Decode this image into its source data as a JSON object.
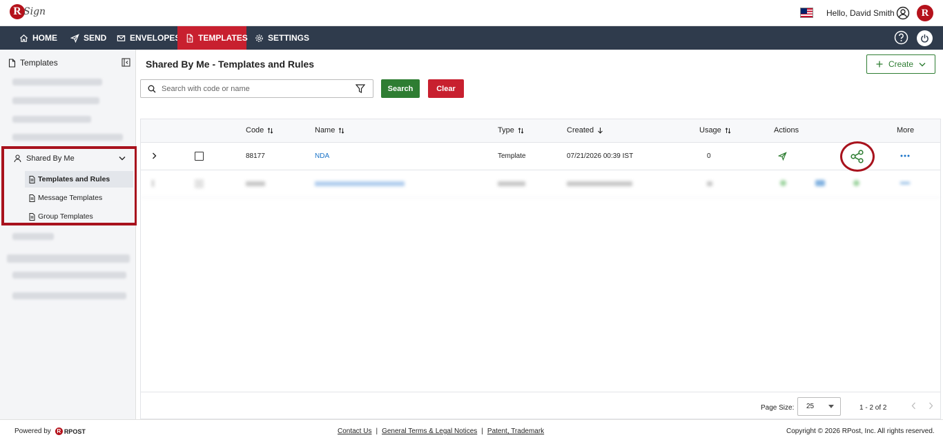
{
  "header": {
    "logo_letter": "R",
    "logo_text": "Sign",
    "greeting": "Hello, David Smith",
    "avatar_letter": "R"
  },
  "nav": {
    "items": [
      {
        "label": "HOME",
        "icon": "home-icon"
      },
      {
        "label": "SEND",
        "icon": "send-icon"
      },
      {
        "label": "ENVELOPES",
        "icon": "envelope-icon"
      },
      {
        "label": "TEMPLATES",
        "icon": "document-icon",
        "active": true
      },
      {
        "label": "SETTINGS",
        "icon": "gear-icon"
      }
    ]
  },
  "sidebar": {
    "title": "Templates",
    "shared_by_me": {
      "label": "Shared By Me",
      "items": [
        {
          "label": "Templates and Rules",
          "active": true
        },
        {
          "label": "Message Templates"
        },
        {
          "label": "Group Templates"
        }
      ]
    }
  },
  "main": {
    "title": "Shared By Me - Templates and Rules",
    "create_label": "Create",
    "search": {
      "placeholder": "Search with code or name"
    },
    "search_label": "Search",
    "clear_label": "Clear",
    "columns": [
      "Code",
      "Name",
      "Type",
      "Created",
      "Usage",
      "Actions",
      "More"
    ],
    "rows": [
      {
        "code": "88177",
        "name": "NDA",
        "type": "Template",
        "created": "07/21/2026 00:39 IST",
        "usage": "0"
      }
    ],
    "pagination": {
      "page_size_label": "Page Size:",
      "page_size": "25",
      "range": "1 - 2 of 2"
    }
  },
  "footer": {
    "powered_by": "Powered by",
    "brand": "RPOST",
    "links": [
      "Contact Us",
      "General Terms & Legal Notices",
      "Patent, Trademark"
    ],
    "separator": "|",
    "copyright": "Copyright © 2026 RPost, Inc. All rights reserved."
  },
  "colors": {
    "brand_red": "#c8202f",
    "nav_bg": "#2f3b4c",
    "accent_green": "#2e7d32",
    "link_blue": "#1a73c8"
  }
}
